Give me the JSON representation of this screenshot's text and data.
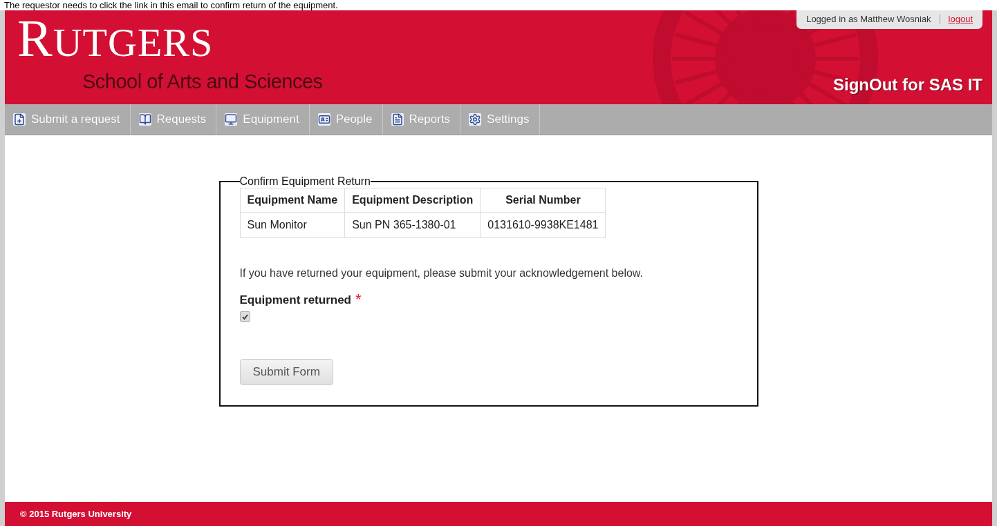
{
  "caption": "The requestor needs to click the link in this email to confirm return of the equipment.",
  "header": {
    "logo": "RUTGERS",
    "subtitle": "School of Arts and Sciences",
    "app_title": "SignOut for SAS IT",
    "user_label": "Logged in as Matthew Wosniak",
    "logout": "logout"
  },
  "nav": [
    {
      "label": "Submit a request",
      "kind": "submit"
    },
    {
      "label": "Requests",
      "kind": "requests"
    },
    {
      "label": "Equipment",
      "kind": "equipment"
    },
    {
      "label": "People",
      "kind": "people"
    },
    {
      "label": "Reports",
      "kind": "reports"
    },
    {
      "label": "Settings",
      "kind": "settings"
    }
  ],
  "form": {
    "legend": "Confirm Equipment Return",
    "table": {
      "columns": [
        "Equipment Name",
        "Equipment Description",
        "Serial Number"
      ],
      "rows": [
        [
          "Sun Monitor",
          "Sun PN 365-1380-01",
          "0131610-9938KE1481"
        ]
      ]
    },
    "instruction": "If you have returned your equipment, please submit your acknowledgement below.",
    "field_label": "Equipment returned",
    "required_mark": "*",
    "checked": true,
    "submit": "Submit Form"
  },
  "footer": "© 2015 Rutgers University"
}
